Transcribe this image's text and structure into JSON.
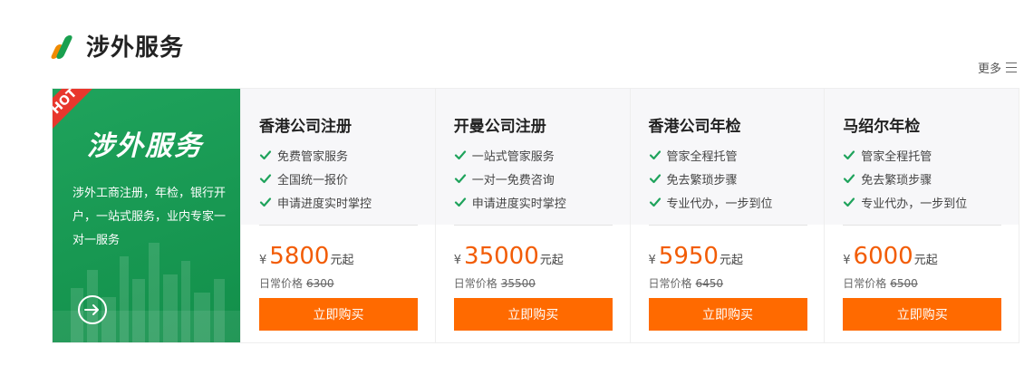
{
  "section": {
    "title": "涉外服务",
    "more_label": "更多"
  },
  "promo": {
    "badge": "HOT",
    "title": "涉外服务",
    "description": "涉外工商注册，年检，银行开户，一站式服务，业内专家一对一服务",
    "arrow_icon": "arrow-right-circle-icon"
  },
  "colors": {
    "brand_green": "#19a04f",
    "accent_orange": "#ff6a00",
    "hot_red": "#e8372d"
  },
  "cards": [
    {
      "title": "香港公司注册",
      "features": [
        "免费管家服务",
        "全国统一报价",
        "申请进度实时掌控"
      ],
      "currency": "¥",
      "price": "5800",
      "price_suffix": "元起",
      "regular_label": "日常价格",
      "regular_price": "6300",
      "button_label": "立即购买"
    },
    {
      "title": "开曼公司注册",
      "features": [
        "一站式管家服务",
        "一对一免费咨询",
        "申请进度实时掌控"
      ],
      "currency": "¥",
      "price": "35000",
      "price_suffix": "元起",
      "regular_label": "日常价格",
      "regular_price": "35500",
      "button_label": "立即购买"
    },
    {
      "title": "香港公司年检",
      "features": [
        "管家全程托管",
        "免去繁琐步骤",
        "专业代办，一步到位"
      ],
      "currency": "¥",
      "price": "5950",
      "price_suffix": "元起",
      "regular_label": "日常价格",
      "regular_price": "6450",
      "button_label": "立即购买"
    },
    {
      "title": "马绍尔年检",
      "features": [
        "管家全程托管",
        "免去繁琐步骤",
        "专业代办，一步到位"
      ],
      "currency": "¥",
      "price": "6000",
      "price_suffix": "元起",
      "regular_label": "日常价格",
      "regular_price": "6500",
      "button_label": "立即购买"
    }
  ]
}
